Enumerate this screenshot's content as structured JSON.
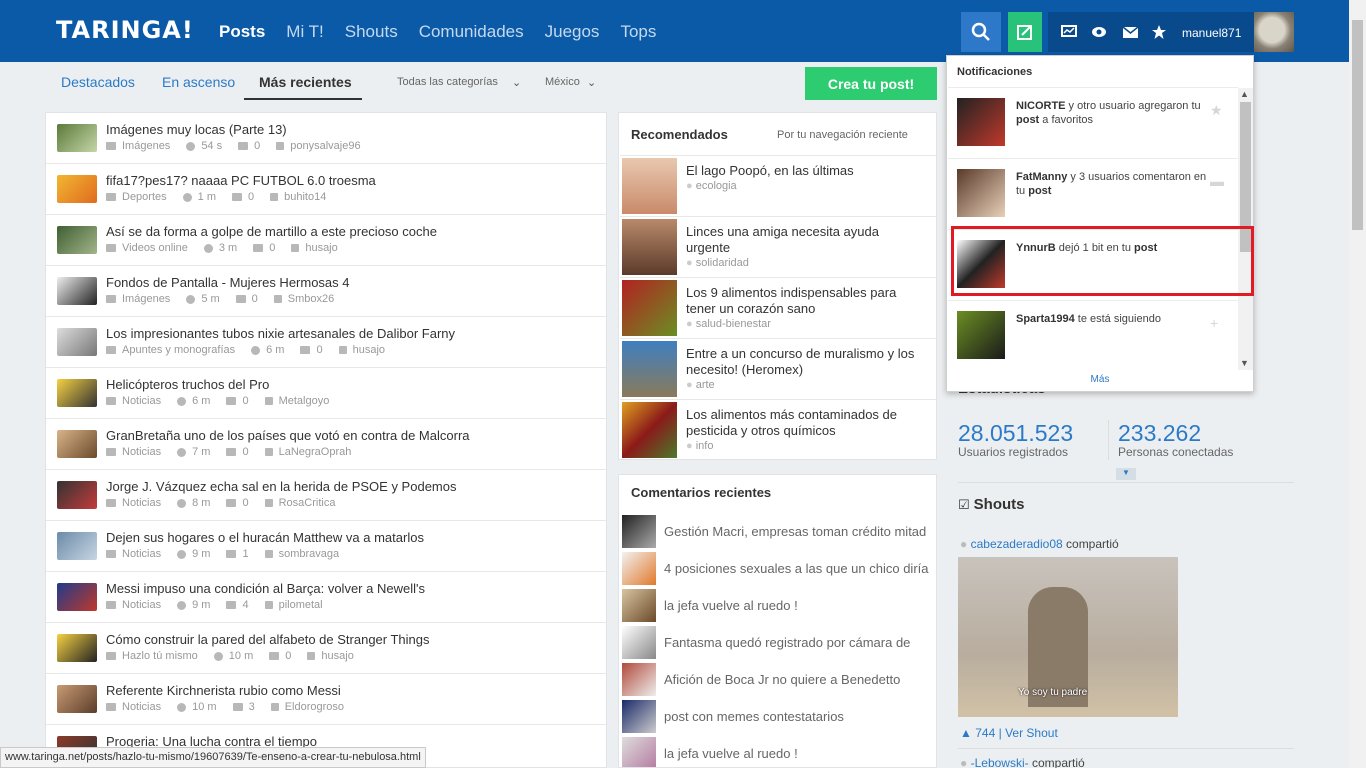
{
  "header": {
    "logo": "TARINGA!",
    "nav": [
      "Posts",
      "Mi T!",
      "Shouts",
      "Comunidades",
      "Juegos",
      "Tops"
    ],
    "username": "manuel871"
  },
  "tabs": {
    "featured": "Destacados",
    "rising": "En ascenso",
    "recent": "Más recientes",
    "category": "Todas las categorías",
    "country": "México"
  },
  "create_button": "Crea tu post!",
  "posts": [
    {
      "title": "Imágenes muy locas (Parte 13)",
      "category": "Imágenes",
      "time": "54 s",
      "comments": "0",
      "user": "ponysalvaje96"
    },
    {
      "title": "fifa17?pes17? naaaa PC FUTBOL 6.0 troesma",
      "category": "Deportes",
      "time": "1 m",
      "comments": "0",
      "user": "buhito14"
    },
    {
      "title": "Así se da forma a golpe de martillo a este precioso coche",
      "category": "Videos online",
      "time": "3 m",
      "comments": "0",
      "user": "husajo"
    },
    {
      "title": "Fondos de Pantalla - Mujeres Hermosas 4",
      "category": "Imágenes",
      "time": "5 m",
      "comments": "0",
      "user": "Smbox26"
    },
    {
      "title": "Los impresionantes tubos nixie artesanales de Dalibor Farny",
      "category": "Apuntes y monografías",
      "time": "6 m",
      "comments": "0",
      "user": "husajo"
    },
    {
      "title": "Helicópteros truchos del Pro",
      "category": "Noticias",
      "time": "6 m",
      "comments": "0",
      "user": "Metalgoyo"
    },
    {
      "title": "GranBretaña uno de los países que votó en contra de Malcorra",
      "category": "Noticias",
      "time": "7 m",
      "comments": "0",
      "user": "LaNegraOprah"
    },
    {
      "title": "Jorge J. Vázquez echa sal en la herida de PSOE y Podemos",
      "category": "Noticias",
      "time": "8 m",
      "comments": "0",
      "user": "RosaCritica"
    },
    {
      "title": "Dejen sus hogares o el huracán Matthew va a matarlos",
      "category": "Noticias",
      "time": "9 m",
      "comments": "1",
      "user": "sombravaga"
    },
    {
      "title": "Messi impuso una condición al Barça: volver a Newell's",
      "category": "Noticias",
      "time": "9 m",
      "comments": "4",
      "user": "pilometal"
    },
    {
      "title": "Cómo construir la pared del alfabeto de Stranger Things",
      "category": "Hazlo tú mismo",
      "time": "10 m",
      "comments": "0",
      "user": "husajo"
    },
    {
      "title": "Referente Kirchnerista rubio como Messi",
      "category": "Noticias",
      "time": "10 m",
      "comments": "3",
      "user": "Eldorogroso"
    },
    {
      "title": "Progeria: Una lucha contra el tiempo",
      "category": "",
      "time": "",
      "comments": "",
      "user": ""
    }
  ],
  "recommended": {
    "title": "Recomendados",
    "filter": "Por tu navegación reciente",
    "items": [
      {
        "title": "El lago Poopó, en las últimas",
        "category": "ecologia"
      },
      {
        "title": "Linces una amiga necesita ayuda urgente",
        "category": "solidaridad"
      },
      {
        "title": "Los 9 alimentos indispensables para tener un corazón sano",
        "category": "salud-bienestar"
      },
      {
        "title": "Entre a un concurso de muralismo y los necesito! (Heromex)",
        "category": "arte"
      },
      {
        "title": "Los alimentos más contaminados de pesticida y otros químicos",
        "category": "info"
      }
    ]
  },
  "comments": {
    "title": "Comentarios recientes",
    "items": [
      "Gestión Macri, empresas toman crédito mitad",
      "4 posiciones sexuales a las que un chico diría",
      "la jefa vuelve al ruedo !",
      "Fantasma quedó registrado por cámara de",
      "Afición de Boca Jr no quiere a Benedetto",
      "post con memes contestatarios",
      "la jefa vuelve al ruedo !"
    ]
  },
  "stats": {
    "title": "Estadísticas",
    "users": "28.051.523",
    "users_label": "Usuarios registrados",
    "online": "233.262",
    "online_label": "Personas conectadas"
  },
  "shouts": {
    "title": "Shouts",
    "user": "cabezaderadio08",
    "action": "compartió",
    "caption": "Yo soy tu padre",
    "likes": "744",
    "see": "Ver Shout",
    "user2": "-Lebowski-",
    "action2": "compartió"
  },
  "notifications": {
    "title": "Notificaciones",
    "more": "Más",
    "items": [
      {
        "user": "NICORTE",
        "pre": " y otro usuario agregaron tu ",
        "link": "post",
        "post": " a favoritos"
      },
      {
        "user": "FatManny",
        "pre": " y 3 usuarios comentaron en tu ",
        "link": "post",
        "post": ""
      },
      {
        "user": "YnnurB",
        "pre": " dejó 1 bit en tu ",
        "link": "post",
        "post": ""
      },
      {
        "user": "Sparta1994",
        "pre": " te está siguiendo",
        "link": "",
        "post": ""
      }
    ]
  },
  "status_url": "www.taringa.net/posts/hazlo-tu-mismo/19607639/Te-enseno-a-crear-tu-nebulosa.html"
}
